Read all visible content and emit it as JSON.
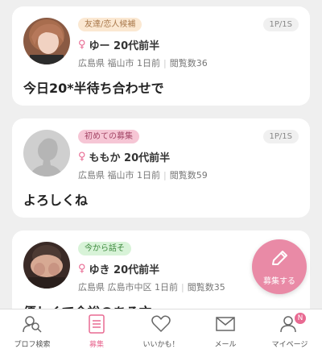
{
  "posts": [
    {
      "tag": "友達/恋人候補",
      "tag_bg": "#fbe8d2",
      "tag_color": "#a8774a",
      "pages": "1P/1S",
      "gender": "♀",
      "name": "ゆー 20代前半",
      "location": "広島県 福山市 1日前",
      "views": "閲覧数36",
      "message": "今日20*半待ち合わせで"
    },
    {
      "tag": "初めての募集",
      "tag_bg": "#f6c6d5",
      "tag_color": "#a34566",
      "pages": "1P/1S",
      "gender": "♀",
      "name": "ももか 20代前半",
      "location": "広島県 福山市 1日前",
      "views": "閲覧数59",
      "message": "よろしくね"
    },
    {
      "tag": "今から話そ",
      "tag_bg": "#d8f3d8",
      "tag_color": "#3f8a3f",
      "pages": "",
      "gender": "♀",
      "name": "ゆき 20代前半",
      "location": "広島県 広島市中区 1日前",
      "views": "閲覧数35",
      "message": "優しくて余裕のある方"
    }
  ],
  "fab": {
    "label": "募集する",
    "icon": "pencil-icon",
    "color": "#e98aa6"
  },
  "tabs": [
    {
      "label": "プロフ検索",
      "icon": "profile-search-icon"
    },
    {
      "label": "募集",
      "icon": "list-icon"
    },
    {
      "label": "いいかも！",
      "icon": "heart-icon"
    },
    {
      "label": "メール",
      "icon": "mail-icon"
    },
    {
      "label": "マイページ",
      "icon": "user-icon",
      "badge": "N"
    }
  ],
  "accent_color": "#e86a92"
}
